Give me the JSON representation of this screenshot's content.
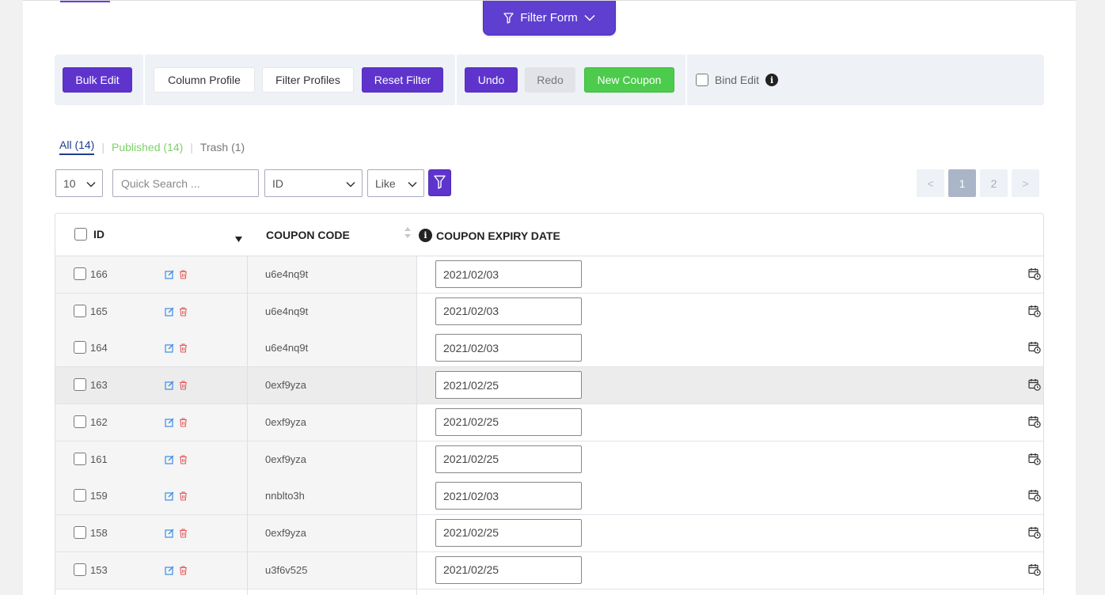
{
  "filter_form": {
    "label": "Filter Form"
  },
  "toolbar": {
    "bulk_edit": "Bulk Edit",
    "column_profile": "Column Profile",
    "filter_profiles": "Filter Profiles",
    "reset_filter": "Reset Filter",
    "undo": "Undo",
    "redo": "Redo",
    "new_coupon": "New Coupon",
    "bind_edit": "Bind Edit",
    "info_glyph": "i"
  },
  "status_tabs": {
    "all": "All (14)",
    "published": "Published (14)",
    "trash": "Trash (1)",
    "separator": "|"
  },
  "controls": {
    "per_page": "10",
    "search_placeholder": "Quick Search ...",
    "field": "ID",
    "operator": "Like"
  },
  "pagination": {
    "prev": "<",
    "pages": [
      "1",
      "2"
    ],
    "next": ">",
    "current": "1"
  },
  "table": {
    "headers": {
      "id": "ID",
      "coupon_code": "COUPON CODE",
      "expiry_date": "COUPON EXPIRY DATE"
    },
    "rows": [
      {
        "id": "166",
        "code": "u6e4nq9t",
        "date": "2021/02/03"
      },
      {
        "id": "165",
        "code": "u6e4nq9t",
        "date": "2021/02/03"
      },
      {
        "id": "164",
        "code": "u6e4nq9t",
        "date": "2021/02/03"
      },
      {
        "id": "163",
        "code": "0exf9yza",
        "date": "2021/02/25"
      },
      {
        "id": "162",
        "code": "0exf9yza",
        "date": "2021/02/25"
      },
      {
        "id": "161",
        "code": "0exf9yza",
        "date": "2021/02/25"
      },
      {
        "id": "159",
        "code": "nnblto3h",
        "date": "2021/02/03"
      },
      {
        "id": "158",
        "code": "0exf9yza",
        "date": "2021/02/25"
      },
      {
        "id": "153",
        "code": "u3f6v525",
        "date": "2021/02/25"
      }
    ]
  },
  "colors": {
    "accent_purple": "#5e34cd",
    "green": "#4ccb4c",
    "published_green": "#7ed069",
    "toolbar_bg": "#eef1f6"
  },
  "icons": [
    "funnel-icon",
    "chevron-down-icon",
    "info-icon",
    "sort-desc-icon",
    "sort-icon",
    "edit-icon",
    "trash-icon",
    "calendar-clock-icon"
  ]
}
